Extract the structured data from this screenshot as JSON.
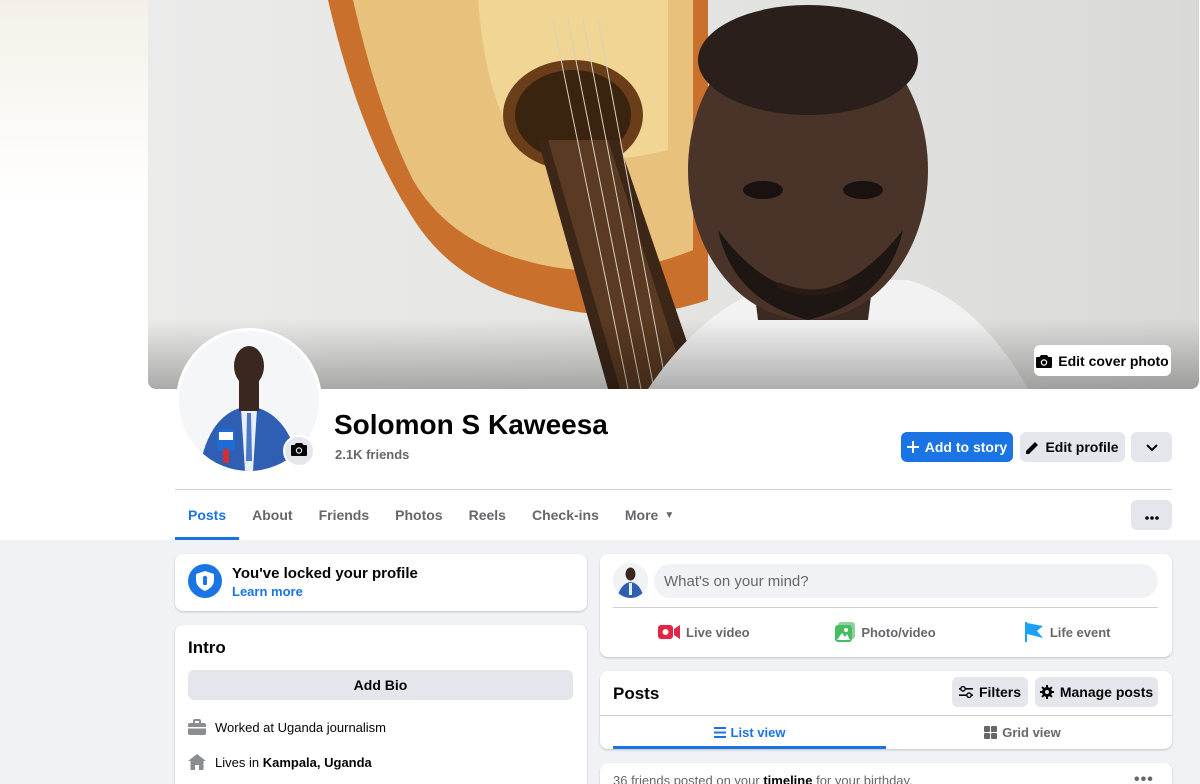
{
  "cover": {
    "edit_label": "Edit cover photo"
  },
  "profile": {
    "name": "Solomon S Kaweesa",
    "friends": "2.1K friends"
  },
  "actions": {
    "add_story": "Add to story",
    "edit_profile": "Edit profile"
  },
  "tabs": [
    {
      "label": "Posts"
    },
    {
      "label": "About"
    },
    {
      "label": "Friends"
    },
    {
      "label": "Photos"
    },
    {
      "label": "Reels"
    },
    {
      "label": "Check-ins"
    },
    {
      "label": "More"
    }
  ],
  "lock": {
    "title": "You've locked your profile",
    "link": "Learn more"
  },
  "intro": {
    "title": "Intro",
    "add_bio": "Add Bio",
    "work": "Worked at Uganda journalism",
    "lives_prefix": "Lives in",
    "lives_place": "Kampala, Uganda"
  },
  "composer": {
    "placeholder": "What's on your mind?",
    "live": "Live video",
    "photo": "Photo/video",
    "life": "Life event"
  },
  "posts": {
    "title": "Posts",
    "filters": "Filters",
    "manage": "Manage posts",
    "list_view": "List view",
    "grid_view": "Grid view"
  },
  "birthday": {
    "prefix": "36 friends posted on your",
    "emph": "timeline",
    "suffix": "for your birthday."
  },
  "colors": {
    "accent": "#1b74e4",
    "background": "#f0f2f5",
    "live_red": "#e42645",
    "photo_green": "#45bd62",
    "flag_blue": "#1ea1f2"
  }
}
